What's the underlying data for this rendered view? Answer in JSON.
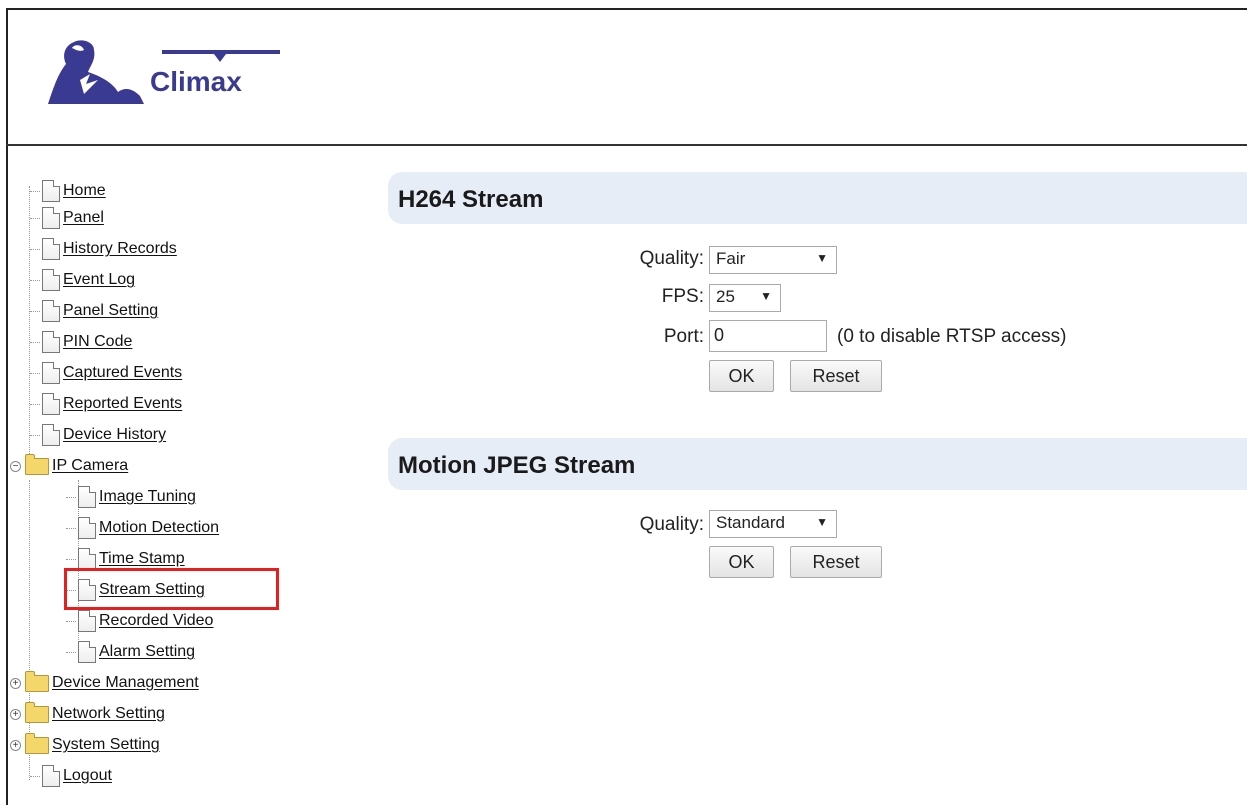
{
  "header": {
    "logo_text": "Climax"
  },
  "tree": {
    "items": [
      {
        "label": "Home"
      },
      {
        "label": "Panel"
      },
      {
        "label": "History Records"
      },
      {
        "label": "Event Log"
      },
      {
        "label": "Panel Setting"
      },
      {
        "label": "PIN Code"
      },
      {
        "label": "Captured Events"
      },
      {
        "label": "Reported Events"
      },
      {
        "label": "Device History"
      },
      {
        "label": "IP Camera",
        "expanded": true
      },
      {
        "label": "Image Tuning"
      },
      {
        "label": "Motion Detection"
      },
      {
        "label": "Time Stamp"
      },
      {
        "label": "Stream Setting",
        "selected": true
      },
      {
        "label": "Recorded Video"
      },
      {
        "label": "Alarm Setting"
      },
      {
        "label": "Device Management",
        "expanded": false
      },
      {
        "label": "Network Setting",
        "expanded": false
      },
      {
        "label": "System Setting",
        "expanded": false
      },
      {
        "label": "Logout"
      }
    ],
    "expand_minus": "−",
    "expand_plus": "+"
  },
  "h264": {
    "title": "H264 Stream",
    "quality_label": "Quality:",
    "quality_value": "Fair",
    "fps_label": "FPS:",
    "fps_value": "25",
    "port_label": "Port:",
    "port_value": "0",
    "port_hint": "(0 to disable RTSP access)",
    "ok_label": "OK",
    "reset_label": "Reset"
  },
  "mjpeg": {
    "title": "Motion JPEG Stream",
    "quality_label": "Quality:",
    "quality_value": "Standard",
    "ok_label": "OK",
    "reset_label": "Reset"
  },
  "icons": {
    "dropdown": "▼"
  },
  "colors": {
    "highlight": "#e81d1d",
    "section_bg": "#e6edf7",
    "brand": "#3b3a93"
  }
}
